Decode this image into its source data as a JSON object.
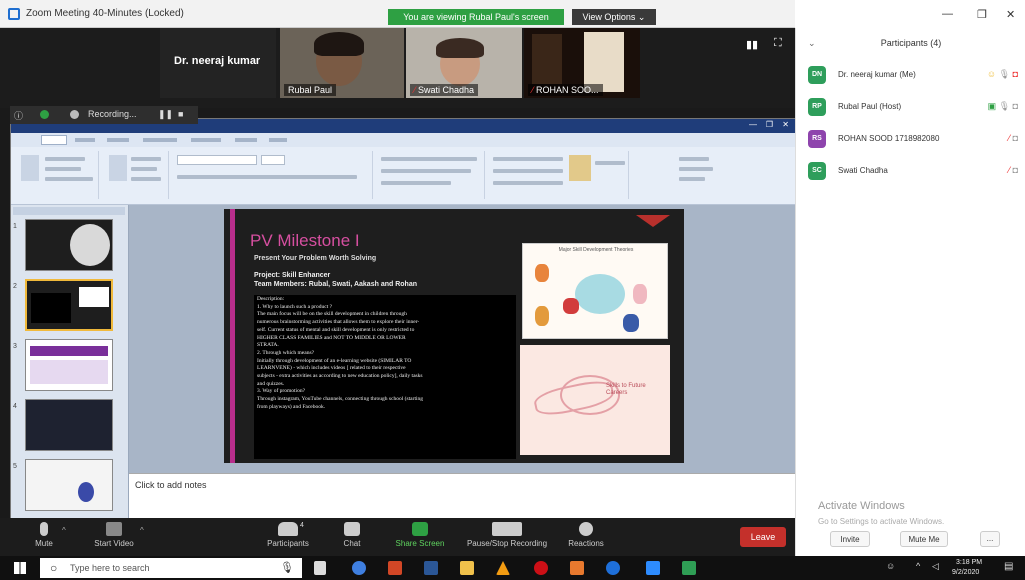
{
  "window": {
    "title": "Zoom Meeting 40-Minutes (Locked)",
    "share_banner": "You are viewing Rubal Paul's screen",
    "view_options": "View Options ⌄"
  },
  "videos": {
    "neeraj_big": "Dr. neeraj kumar",
    "rubal": "Rubal Paul",
    "swati": "Swati Chadha",
    "rohan": "ROHAN SOO..."
  },
  "recording": {
    "label": "Recording..."
  },
  "slide": {
    "title": "PV Milestone I",
    "subtitle": "Present Your Problem Worth Solving",
    "project": "Project: Skill Enhancer",
    "team": "Team Members: Rubal, Swati, Aakash and Rohan",
    "body": [
      "Description:",
      "1. Why to launch such a product ?",
      "The main focus will be on the skill development in children through",
      "numerous brainstorming activities that allows them to explore their inner-",
      "self. Current status of mental and skill development is only restricted to",
      "HIGHER CLASS FAMILIES and NOT TO MIDDLE OR LOWER",
      "STRATA.",
      "2. Through which means?",
      "Initially through development of an e-learning website (SIMILAR TO",
      "LEARNVENE) - which includes videos [ related to their respective",
      "subjects - extra activities as according to new education policy], daily tasks",
      "and quizzes.",
      "3. Way of promotion?",
      "Through instagram, YouTube channels, connecting through school (starting",
      "from playways) and Facebook."
    ],
    "image1_caption": "Major Skill Development Theories",
    "image2_caption": "Skills to Future Careers"
  },
  "notes": {
    "placeholder": "Click to add notes"
  },
  "toolbar": {
    "mute": "Mute",
    "start_video": "Start Video",
    "participants": "Participants",
    "participants_count": "4",
    "chat": "Chat",
    "share_screen": "Share Screen",
    "pause_recording": "Pause/Stop Recording",
    "reactions": "Reactions",
    "leave": "Leave"
  },
  "panel": {
    "title": "Participants (4)",
    "participants": [
      {
        "initials": "DN",
        "name": "Dr. neeraj kumar (Me)",
        "color": "#2e9e5b"
      },
      {
        "initials": "RP",
        "name": "Rubal Paul (Host)",
        "color": "#2e9e5b"
      },
      {
        "initials": "RS",
        "name": "ROHAN SOOD 1718982080",
        "color": "#8e44ad"
      },
      {
        "initials": "SC",
        "name": "Swati Chadha",
        "color": "#2e9e5b"
      }
    ],
    "activate_title": "Activate Windows",
    "activate_sub": "Go to Settings to activate Windows.",
    "invite": "Invite",
    "mute_me": "Mute Me",
    "more": "..."
  },
  "taskbar": {
    "search_placeholder": "Type here to search",
    "time": "3:18 PM",
    "date": "9/2/2020"
  },
  "colors": {
    "accent_green": "#2ea043",
    "leave_red": "#c4302b",
    "slide_pink": "#d64fa0"
  }
}
